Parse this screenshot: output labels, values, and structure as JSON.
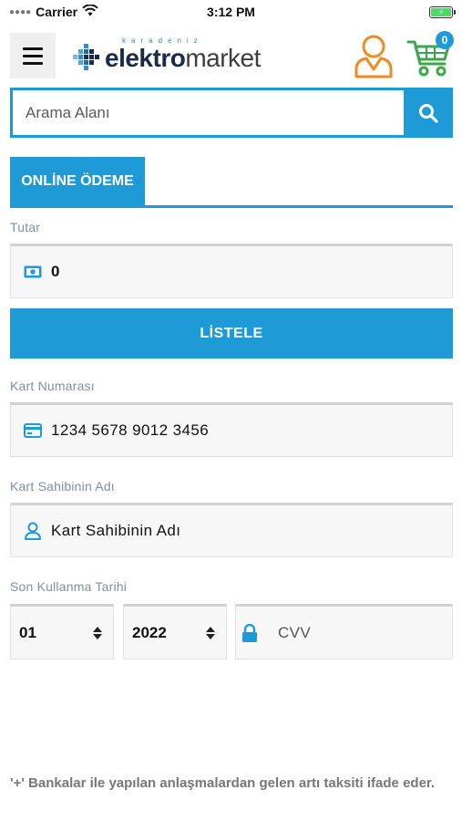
{
  "status_bar": {
    "carrier": "Carrier",
    "time": "3:12 PM",
    "battery_state": "charging"
  },
  "header": {
    "menu_icon": "hamburger-menu-icon",
    "logo": {
      "small_text": "karadeniz",
      "text_a": "elektro",
      "text_b": "market"
    },
    "user_icon": "user-icon",
    "cart_icon": "cart-icon",
    "cart_count": "0",
    "colors": {
      "user": "#f08a22",
      "cart": "#3aa84a",
      "badge": "#1e9bd7"
    }
  },
  "search": {
    "placeholder": "Arama Alanı",
    "button_icon": "search-icon"
  },
  "tabs": [
    {
      "label": "ONLİNE ÖDEME",
      "active": true
    }
  ],
  "form": {
    "amount_label": "Tutar",
    "amount_value": "0",
    "amount_icon": "money-icon",
    "list_button": "LİSTELE",
    "card_number_label": "Kart Numarası",
    "card_number_value": "1234 5678 9012 3456",
    "card_icon": "credit-card-icon",
    "card_holder_label": "Kart Sahibinin Adı",
    "card_holder_value": "Kart Sahibinin Adı",
    "card_holder_icon": "user-outline-icon",
    "expiry_label": "Son Kullanma Tarihi",
    "expiry_month": "01",
    "expiry_year": "2022",
    "cvv_placeholder": "CVV",
    "cvv_icon": "lock-icon"
  },
  "footer_note": "'+' Bankalar ile yapılan anlaşmalardan gelen artı taksiti ifade eder.",
  "theme": {
    "accent": "#1e9bd7",
    "label": "#7f8fa6",
    "field_bg": "#f7f7f7"
  }
}
